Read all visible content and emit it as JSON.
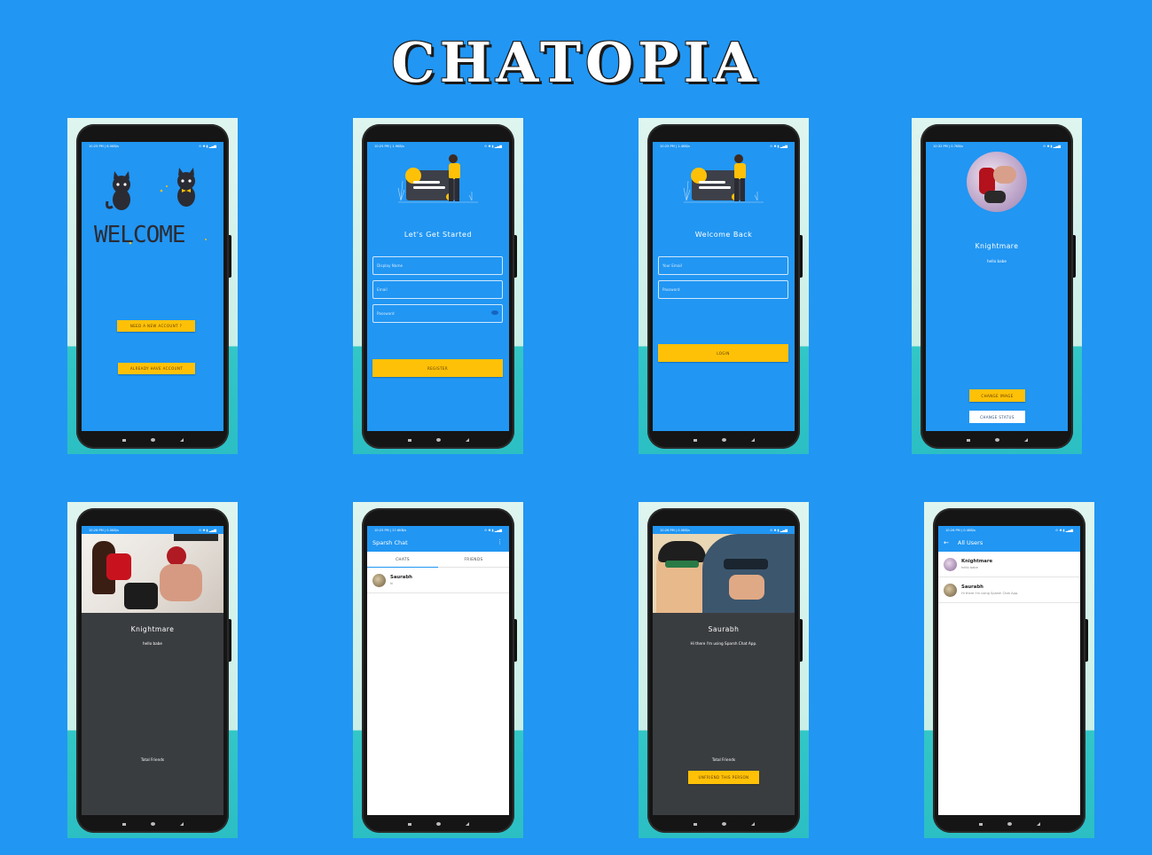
{
  "app_title": "CHATOPIA",
  "status_times": [
    "10:25 PM | 6.0KB/s",
    "10:25 PM | 1.9KB/s",
    "10:25 PM | 1.4KB/s",
    "10:32 PM | 0.7KB/s",
    "10:26 PM | 0.0KB/s",
    "10:25 PM | 27.6KB/s",
    "10:26 PM | 0.0KB/s",
    "10:26 PM | 0.4KB/s"
  ],
  "screen1": {
    "welcome_text": "WELCOME",
    "btn_new": "NEED A NEW ACCOUNT ?",
    "btn_existing": "ALREADY HAVE ACCOUNT"
  },
  "screen2": {
    "heading": "Let's Get Started",
    "display_name_placeholder": "Display Name",
    "email_placeholder": "Email",
    "password_placeholder": "Password",
    "btn_register": "REGISTER"
  },
  "screen3": {
    "heading": "Welcome Back",
    "email_placeholder": "Your Email",
    "password_placeholder": "Password",
    "btn_login": "LOGIN"
  },
  "screen4": {
    "name": "Knightmare",
    "status": "hello babe",
    "btn_change_image": "CHANGE IMAGE",
    "btn_change_status": "CHANGE STATUS"
  },
  "screen5": {
    "name": "Knightmare",
    "status": "hello babe",
    "total_friends": "Total Friends"
  },
  "screen6": {
    "appbar_title": "Sparsh Chat",
    "tab_chats": "CHATS",
    "tab_friends": "FRIENDS",
    "chats": [
      {
        "name": "Saurabh",
        "message": "hi"
      }
    ]
  },
  "screen7": {
    "name": "Saurabh",
    "status": "Hi there I'm using Sparsh Chat App.",
    "total_friends": "Total Friends",
    "btn_unfriend": "UNFRIEND THIS PERSON"
  },
  "screen8": {
    "appbar_title": "All Users",
    "users": [
      {
        "name": "Knightmare",
        "status": "hello babe"
      },
      {
        "name": "Saurabh",
        "status": "Hi there I'm using Sparsh Chat App."
      }
    ]
  },
  "colors": {
    "background": "#2196F3",
    "accent": "#FFC107",
    "dark": "#3a3d40"
  }
}
